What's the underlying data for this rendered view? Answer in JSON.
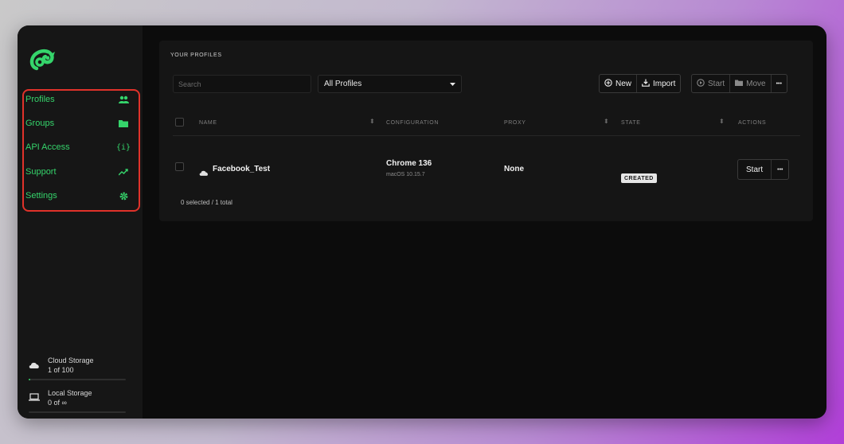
{
  "sidebar": {
    "nav": [
      {
        "label": "Profiles",
        "icon": "users-icon"
      },
      {
        "label": "Groups",
        "icon": "folder-icon"
      },
      {
        "label": "API Access",
        "icon": "braces-icon"
      },
      {
        "label": "Support",
        "icon": "trend-icon"
      },
      {
        "label": "Settings",
        "icon": "gear-icon"
      }
    ],
    "storage": [
      {
        "title": "Cloud Storage",
        "usage": "1 of 100",
        "icon": "cloud-icon",
        "fill": 0.01
      },
      {
        "title": "Local Storage",
        "usage": "0 of ∞",
        "icon": "laptop-icon",
        "fill": 0
      }
    ]
  },
  "main": {
    "section_title": "YOUR PROFILES",
    "search_placeholder": "Search",
    "filter_selected": "All Profiles",
    "toolbar": {
      "new_label": "New",
      "import_label": "Import",
      "start_label": "Start",
      "move_label": "Move",
      "more_label": "•••"
    },
    "table": {
      "headers": {
        "name": "NAME",
        "configuration": "CONFIGURATION",
        "proxy": "PROXY",
        "state": "STATE",
        "actions": "ACTIONS"
      },
      "rows": [
        {
          "name": "Facebook_Test",
          "browser": "Chrome 136",
          "os": "macOS 10.15.7",
          "proxy": "None",
          "state": "CREATED",
          "start_label": "Start",
          "more_label": "•••"
        }
      ]
    },
    "selection_summary": "0 selected / 1 total"
  },
  "colors": {
    "accent": "#35d46b",
    "highlight_border": "#e0322a"
  }
}
